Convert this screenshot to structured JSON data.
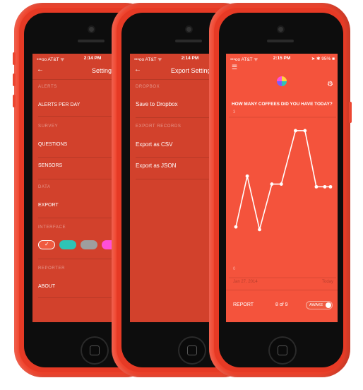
{
  "status_bar": {
    "carrier": "•••oo AT&T ᯤ",
    "time_settings": "2:14 PM",
    "time_export": "2:14 PM",
    "time_chart": "2:15 PM",
    "battery": "■",
    "right_chart": "➤ ✱ 95% ■"
  },
  "settings": {
    "back": "←",
    "title": "Settings",
    "sections": {
      "alerts": "ALERTS",
      "survey": "SURVEY",
      "data": "DATA",
      "interface": "INTERFACE",
      "reporter": "REPORTER"
    },
    "items": {
      "alerts_per_day": "ALERTS PER DAY",
      "questions": "QUESTIONS",
      "sensors": "SENSORS",
      "export": "EXPORT",
      "about": "ABOUT"
    },
    "selected_check": "✓",
    "swatch_colors": [
      "#f05a40",
      "#2ec4b6",
      "#9e9e9e",
      "#ff4fd8"
    ]
  },
  "export": {
    "back": "←",
    "title": "Export Settings",
    "sections": {
      "dropbox": "DROPBOX",
      "records": "EXPORT RECORDS"
    },
    "items": {
      "save_dropbox": "Save to Dropbox",
      "csv": "Export as CSV",
      "json": "Export as JSON"
    }
  },
  "report": {
    "menu_icon": "☰",
    "gear_icon": "⚙",
    "question": "HOW MANY COFFEES DID YOU HAVE TODAY?",
    "y_top": "3",
    "y_bottom": "0",
    "date_start": "Jan 27, 2014",
    "date_end": "Today",
    "report_label": "REPORT",
    "pager": "8 of 9",
    "toggle_label": "AWAKE",
    "chart_color": "#ffffff",
    "screen_color": "#f4533c"
  },
  "chart_data": {
    "type": "line",
    "title": "HOW MANY COFFEES DID YOU HAVE TODAY?",
    "x": [
      "Jan 27, 2014",
      "",
      "",
      "",
      "",
      "",
      "",
      "",
      "",
      "",
      "Today"
    ],
    "ylim": [
      0,
      3
    ],
    "values": [
      0.95,
      1.9,
      0.9,
      1.75,
      1.75,
      2.75,
      2.75,
      1.7,
      1.7,
      1.7
    ],
    "grid": true
  }
}
